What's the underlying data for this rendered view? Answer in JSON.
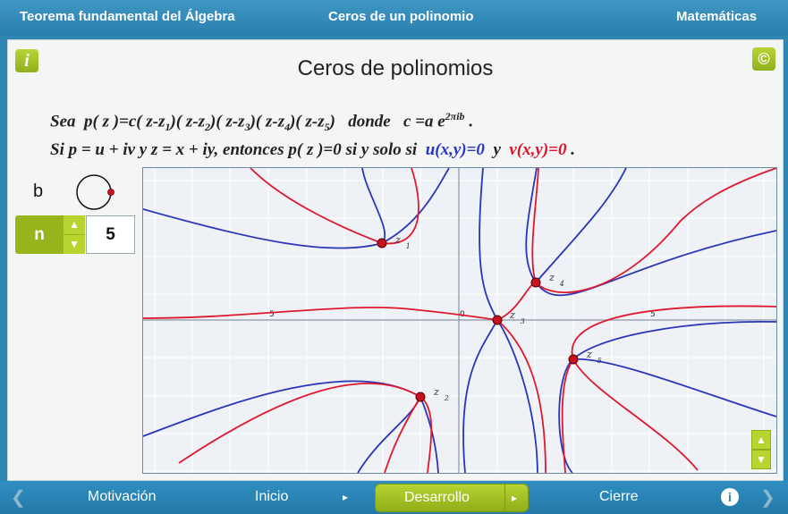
{
  "topbar": {
    "left": "Teorema fundamental del Álgebra",
    "center": "Ceros de un polinomio",
    "right": "Matemáticas"
  },
  "panel": {
    "info_icon": "i",
    "copyright_icon": "©",
    "title": "Ceros de polinomios",
    "formula1": {
      "sea": "Sea",
      "p": "p( z )=c( z-z",
      "f1": ")( z-z",
      "f2": ")( z-z",
      "f3": ")( z-z",
      "f4": ")( z-z",
      "f5": ")",
      "subs": [
        "1",
        "2",
        "3",
        "4",
        "5"
      ],
      "donde": "donde",
      "c": "c =a e",
      "exp": "2πib",
      "dot": "."
    },
    "formula2": {
      "text": "Si p = u + iv  y  z = x + iy, entonces  p( z )=0  si y solo si",
      "u": "u(x,y)=0",
      "y": "y",
      "v": "v(x,y)=0",
      "dot": "."
    },
    "b_label": "b",
    "n_label": "n",
    "n_value": "5",
    "up_arrow": "▲",
    "down_arrow": "▼"
  },
  "graph": {
    "tick_labels": {
      "neg5": "5",
      "zero": "0",
      "pos5": "5"
    },
    "zero_labels": [
      "z",
      "z",
      "z",
      "z",
      "z"
    ],
    "zero_subs": [
      "1",
      "2",
      "3",
      "4",
      "5"
    ],
    "colors": {
      "u": "#2a35b8",
      "v": "#e0182e",
      "zero": "#c8101f"
    }
  },
  "bottombar": {
    "prev": "❮",
    "motivacion": "Motivación",
    "inicio": "Inicio",
    "desarrollo": "Desarrollo",
    "cierre": "Cierre",
    "info": "i",
    "next": "❯",
    "small_arrow": "▸"
  }
}
